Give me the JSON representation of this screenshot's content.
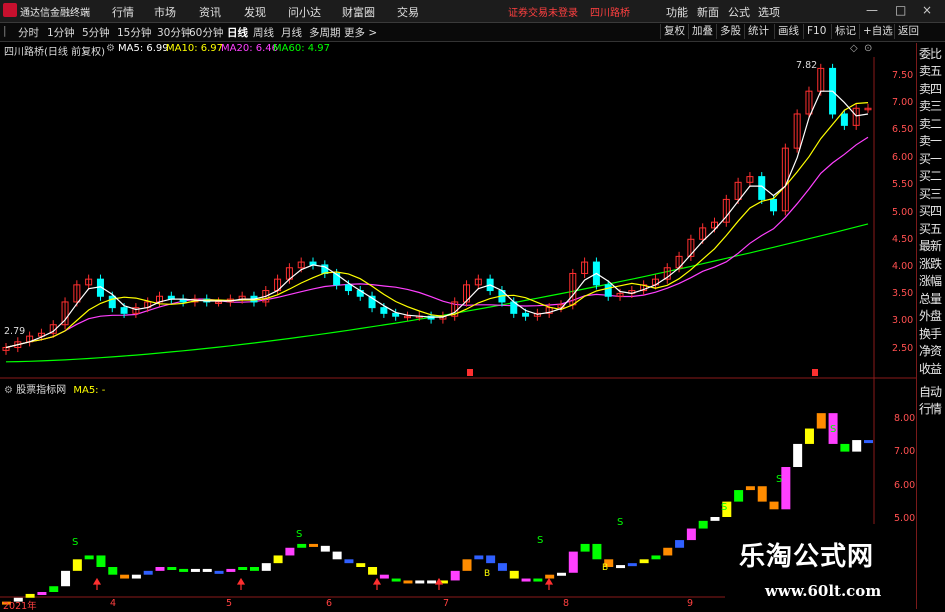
{
  "app": {
    "title": "通达信金融终端",
    "warning": "证券交易未登录",
    "stock": "四川路桥"
  },
  "menu": [
    "行情",
    "市场",
    "资讯",
    "发现",
    "问小达",
    "财富圈",
    "交易"
  ],
  "right_menu": [
    "功能",
    "新面",
    "公式",
    "选项"
  ],
  "window_buttons": [
    "—",
    "□",
    "×"
  ],
  "periods": [
    "分时",
    "1分钟",
    "5分钟",
    "15分钟",
    "30分钟",
    "60分钟",
    "日线",
    "周线",
    "月线",
    "多周期",
    "更多 >"
  ],
  "active_period": "日线",
  "right_tools": [
    "复权",
    "加叠",
    "多股",
    "统计",
    "画线",
    "F10",
    "标记",
    "+自选",
    "返回"
  ],
  "info": {
    "name": "四川路桥(日线 前复权)",
    "ma5": "MA5: 6.99",
    "ma10": "MA10: 6.97",
    "ma20": "MA20: 6.46",
    "ma60": "MA60: 4.97"
  },
  "colors": {
    "ma5": "#ffffff",
    "ma10": "#ffff00",
    "ma20": "#ff40ff",
    "ma60": "#00ff00",
    "up": "#ff3030",
    "down": "#00ffff"
  },
  "price_axis": [
    "7.50",
    "7.00",
    "6.50",
    "6.00",
    "5.50",
    "5.00",
    "4.50",
    "4.00",
    "3.50",
    "3.00",
    "2.50"
  ],
  "high_label": "7.82",
  "low_label": "2.79",
  "right_panel": [
    "委比",
    "卖五",
    "卖四",
    "卖三",
    "卖二",
    "卖一",
    "买一",
    "买二",
    "买三",
    "买四",
    "买五",
    "最新",
    "涨跌",
    "涨幅",
    "总量",
    "外盘",
    "换手",
    "净资",
    "收益",
    "自动",
    "行情"
  ],
  "indicator": {
    "name": "股票指标网",
    "ma": "MA5: -",
    "axis": [
      "8.00",
      "7.00",
      "6.00",
      "5.00"
    ]
  },
  "dates": [
    "2021年",
    "4",
    "5",
    "6",
    "7",
    "8",
    "9"
  ],
  "marker_s": "S",
  "marker_b": "B",
  "watermark": {
    "cn": "乐淘公式网",
    "url": "www.60lt.com"
  },
  "chart_data": {
    "type": "candlestick",
    "title": "四川路桥(日线 前复权)",
    "ylim": [
      2.3,
      7.9
    ],
    "close_approx": [
      2.8,
      2.9,
      3.0,
      3.05,
      3.2,
      3.6,
      3.9,
      4.0,
      3.7,
      3.5,
      3.4,
      3.5,
      3.6,
      3.7,
      3.65,
      3.6,
      3.65,
      3.6,
      3.6,
      3.65,
      3.7,
      3.6,
      3.8,
      4.0,
      4.2,
      4.3,
      4.25,
      4.1,
      3.9,
      3.8,
      3.7,
      3.5,
      3.4,
      3.35,
      3.35,
      3.35,
      3.3,
      3.35,
      3.6,
      3.9,
      4.0,
      3.8,
      3.6,
      3.4,
      3.35,
      3.4,
      3.5,
      3.55,
      4.1,
      4.3,
      3.9,
      3.7,
      3.75,
      3.8,
      3.9,
      4.0,
      4.2,
      4.4,
      4.7,
      4.9,
      5.0,
      5.4,
      5.7,
      5.8,
      5.4,
      5.2,
      6.3,
      6.9,
      7.3,
      7.7,
      6.9,
      6.7,
      7.0,
      7.0
    ],
    "ma5": "white line following close",
    "ma10": "yellow line",
    "ma20": "magenta line ending 6.46",
    "ma60": "green line ending 4.97"
  }
}
